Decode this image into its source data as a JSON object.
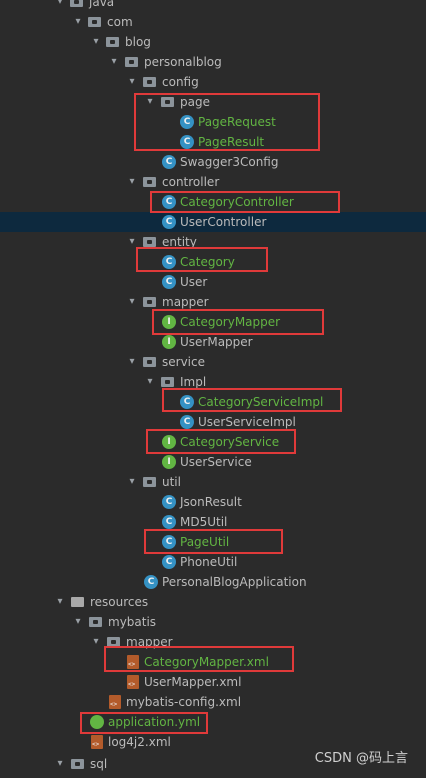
{
  "tree": {
    "java": "java",
    "com": "com",
    "blog": "blog",
    "personalblog": "personalblog",
    "config": "config",
    "page": "page",
    "page_request": "PageRequest",
    "page_result": "PageResult",
    "swagger3config": "Swagger3Config",
    "controller": "controller",
    "category_controller": "CategoryController",
    "user_controller": "UserController",
    "entity": "entity",
    "category": "Category",
    "user": "User",
    "mapper": "mapper",
    "category_mapper": "CategoryMapper",
    "user_mapper": "UserMapper",
    "service": "service",
    "impl": "Impl",
    "category_service_impl": "CategoryServiceImpl",
    "user_service_impl": "UserServiceImpl",
    "category_service": "CategoryService",
    "user_service": "UserService",
    "util": "util",
    "json_result": "JsonResult",
    "md5_util": "MD5Util",
    "page_util": "PageUtil",
    "phone_util": "PhoneUtil",
    "personal_blog_application": "PersonalBlogApplication",
    "resources": "resources",
    "mybatis": "mybatis",
    "mapper_res": "mapper",
    "category_mapper_xml": "CategoryMapper.xml",
    "user_mapper_xml": "UserMapper.xml",
    "mybatis_config_xml": "mybatis-config.xml",
    "application_yml": "application.yml",
    "log4j2_xml": "log4j2.xml",
    "sql": "sql"
  },
  "icons": {
    "class": "C",
    "interface": "I"
  },
  "watermark": "CSDN @码上言",
  "colors": {
    "background": "#2b2b2b",
    "highlight_box": "#e03a3a",
    "changed_file": "#62b543",
    "selected_row": "#0d293e"
  }
}
